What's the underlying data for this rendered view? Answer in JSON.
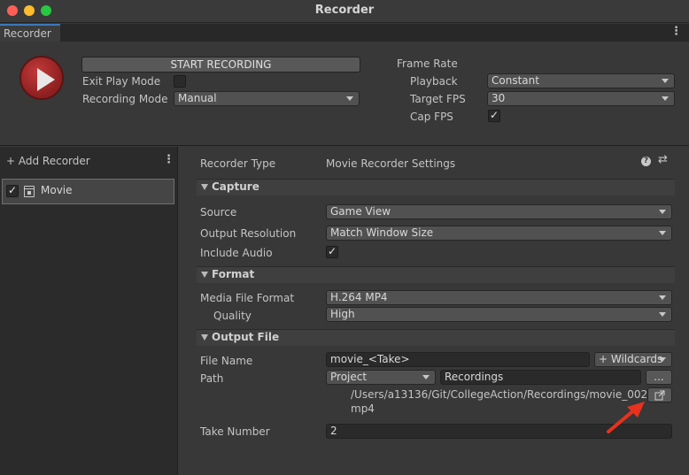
{
  "window": {
    "title": "Recorder"
  },
  "tab": {
    "label": "Recorder",
    "menu_glyph": "⋮"
  },
  "controls": {
    "start_recording": "START RECORDING",
    "exit_play_mode_label": "Exit Play Mode",
    "exit_play_mode_checked": false,
    "recording_mode_label": "Recording Mode",
    "recording_mode_value": "Manual"
  },
  "frame_rate": {
    "heading": "Frame Rate",
    "playback_label": "Playback",
    "playback_value": "Constant",
    "target_fps_label": "Target FPS",
    "target_fps_value": "30",
    "cap_fps_label": "Cap FPS",
    "cap_fps_checked": true
  },
  "recorder_list": {
    "add_label": "+ Add Recorder",
    "menu_glyph": "⋮",
    "items": [
      {
        "name": "Movie",
        "enabled": true
      }
    ]
  },
  "settings": {
    "recorder_type_label": "Recorder Type",
    "recorder_type_value": "Movie Recorder Settings",
    "help_glyph": "?",
    "preset_glyph": "⇄",
    "capture": {
      "title": "Capture",
      "source_label": "Source",
      "source_value": "Game View",
      "output_resolution_label": "Output Resolution",
      "output_resolution_value": "Match Window Size",
      "include_audio_label": "Include Audio",
      "include_audio_checked": true
    },
    "format": {
      "title": "Format",
      "media_file_format_label": "Media File Format",
      "media_file_format_value": "H.264 MP4",
      "quality_label": "Quality",
      "quality_value": "High"
    },
    "output_file": {
      "title": "Output File",
      "file_name_label": "File Name",
      "file_name_value": "movie_<Take>",
      "wildcards_label": "+ Wildcards",
      "path_label": "Path",
      "path_root_value": "Project",
      "path_folder_value": "Recordings",
      "browse_label": "...",
      "resolved_path_line1": "/Users/a13136/Git/CollegeAction/Recordings/movie_002.",
      "resolved_path_line2": "mp4",
      "take_number_label": "Take Number",
      "take_number_value": "2"
    }
  },
  "colors": {
    "record_button": "#b52a2a",
    "annotation_arrow": "#e8321e",
    "tab_accent": "#3a79bb"
  }
}
